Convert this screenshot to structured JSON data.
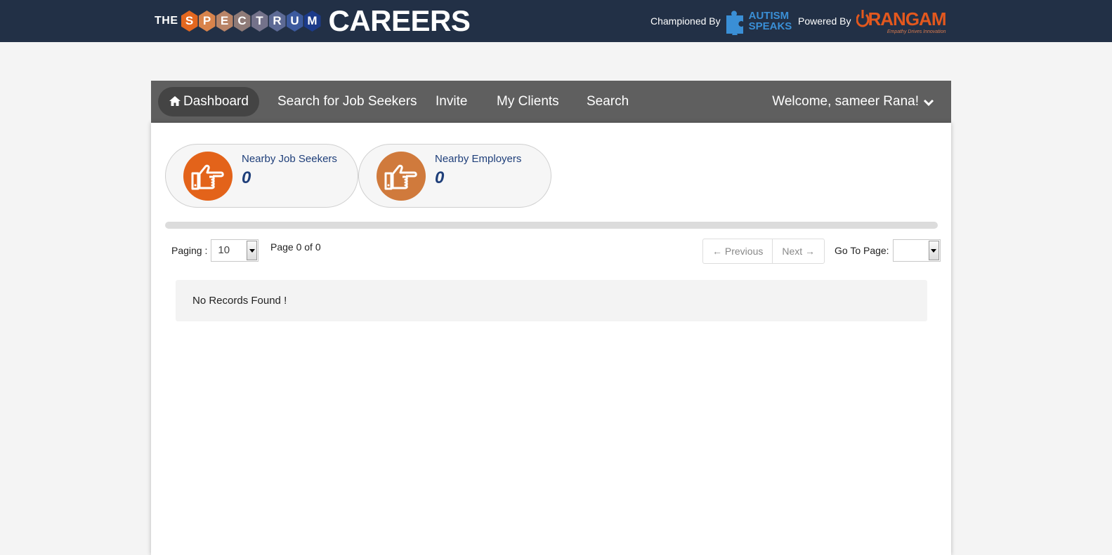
{
  "header": {
    "brand_prefix": "THE",
    "brand_letters": [
      "S",
      "P",
      "E",
      "C",
      "T",
      "R",
      "U",
      "M"
    ],
    "brand_colors": [
      "#e3671f",
      "#d8834b",
      "#b98467",
      "#8f7b78",
      "#74728a",
      "#5d6a95",
      "#3c5a9e",
      "#1c3b8a"
    ],
    "brand_main": "CAREERS",
    "championed_label": "Championed By",
    "autism_line1": "AUTISM",
    "autism_line2": "SPEAKS",
    "powered_label": "Powered By",
    "rangam_name": "RANGAM",
    "rangam_tagline": "Empathy Drives Innovation"
  },
  "nav": {
    "items": [
      {
        "label": "Dashboard",
        "icon": "home-icon",
        "active": true
      },
      {
        "label": "Search for Job Seekers"
      },
      {
        "label": "Invite"
      },
      {
        "label": "My Clients"
      },
      {
        "label": "Search"
      }
    ],
    "welcome": "Welcome, sameer Rana!"
  },
  "stats": [
    {
      "label": "Nearby Job Seekers",
      "value": "0",
      "color": "#e3631a",
      "icon": "pointing-hand-icon"
    },
    {
      "label": "Nearby Employers",
      "value": "0",
      "color": "#d07a3c",
      "icon": "pointing-hand-icon"
    }
  ],
  "paging": {
    "label": "Paging :",
    "size": "10",
    "page_info": "Page 0 of 0",
    "prev": "← Previous",
    "next": "Next →",
    "goto_label": "Go To Page:",
    "goto_value": ""
  },
  "results": {
    "empty_message": "No Records Found !"
  }
}
